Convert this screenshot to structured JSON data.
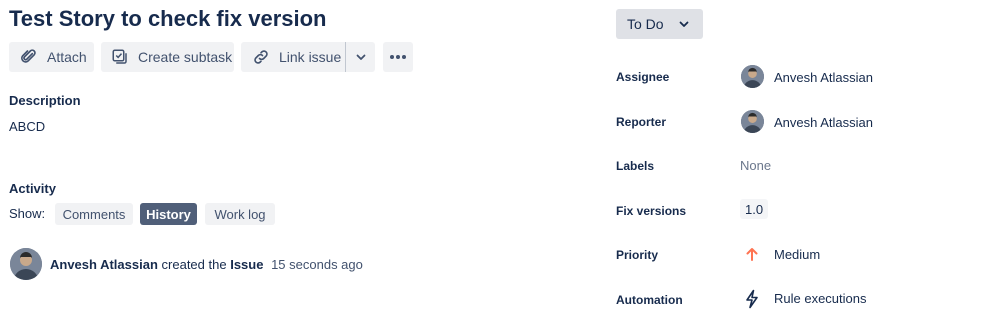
{
  "issue": {
    "title": "Test Story to check fix version"
  },
  "toolbar": {
    "attach_label": "Attach",
    "create_subtask_label": "Create subtask",
    "link_issue_label": "Link issue"
  },
  "description": {
    "heading": "Description",
    "text": "ABCD"
  },
  "activity": {
    "heading": "Activity",
    "show_label": "Show:",
    "tabs": [
      {
        "label": "Comments",
        "active": false
      },
      {
        "label": "History",
        "active": true
      },
      {
        "label": "Work log",
        "active": false
      }
    ],
    "entries": [
      {
        "user": "Anvesh Atlassian",
        "action": "created the",
        "object": "Issue",
        "time": "15 seconds ago"
      }
    ]
  },
  "status": {
    "label": "To Do"
  },
  "fields": {
    "assignee": {
      "label": "Assignee",
      "value": "Anvesh Atlassian"
    },
    "reporter": {
      "label": "Reporter",
      "value": "Anvesh Atlassian"
    },
    "labels": {
      "label": "Labels",
      "value": "None"
    },
    "fix_versions": {
      "label": "Fix versions",
      "value": "1.0"
    },
    "priority": {
      "label": "Priority",
      "value": "Medium",
      "color": "#ff7452"
    },
    "automation": {
      "label": "Automation",
      "value": "Rule executions"
    }
  },
  "colors": {
    "accent": "#505f79",
    "button_bg": "#f1f2f4",
    "text": "#172b4d",
    "muted": "#6b778c"
  },
  "icons": [
    "paperclip-icon",
    "subtask-icon",
    "link-icon",
    "chevron-down-icon",
    "more-icon",
    "priority-arrow-up-icon",
    "lightning-icon"
  ]
}
